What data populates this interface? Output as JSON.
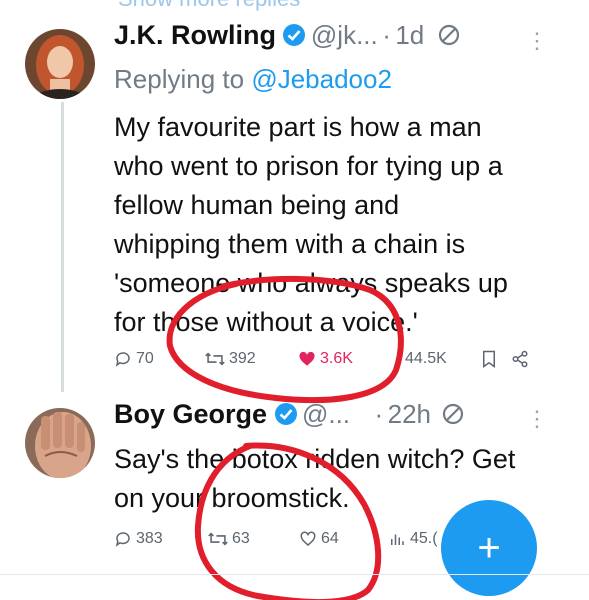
{
  "top_partial": {
    "label": "Show more replies"
  },
  "tweet1": {
    "name": "J.K. Rowling",
    "handle": "@jk...",
    "separator": "·",
    "time": "1d",
    "reply_to_prefix": "Replying to",
    "reply_to_user": "@Jebadoo2",
    "lines": [
      "My favourite part is how a man",
      "who went to prison for tying up a",
      "fellow human being and",
      "whipping them with a chain is",
      "'someone who always speaks up",
      "for those without a voice.'"
    ],
    "stats": {
      "replies": "70",
      "retweets": "392",
      "likes": "3.6K",
      "views": "44.5K"
    }
  },
  "tweet2": {
    "name": "Boy George",
    "handle": "@...",
    "separator": "·",
    "time": "22h",
    "lines": [
      "Say's the botox ridden witch? Get",
      "on your broomstick."
    ],
    "stats": {
      "replies": "383",
      "retweets": "63",
      "likes": "64",
      "views": "45.("
    }
  },
  "compose_button": {
    "icon": "+"
  },
  "colors": {
    "accent": "#1d9bf0",
    "like": "#e0245e",
    "annotation": "#e01e2c"
  }
}
